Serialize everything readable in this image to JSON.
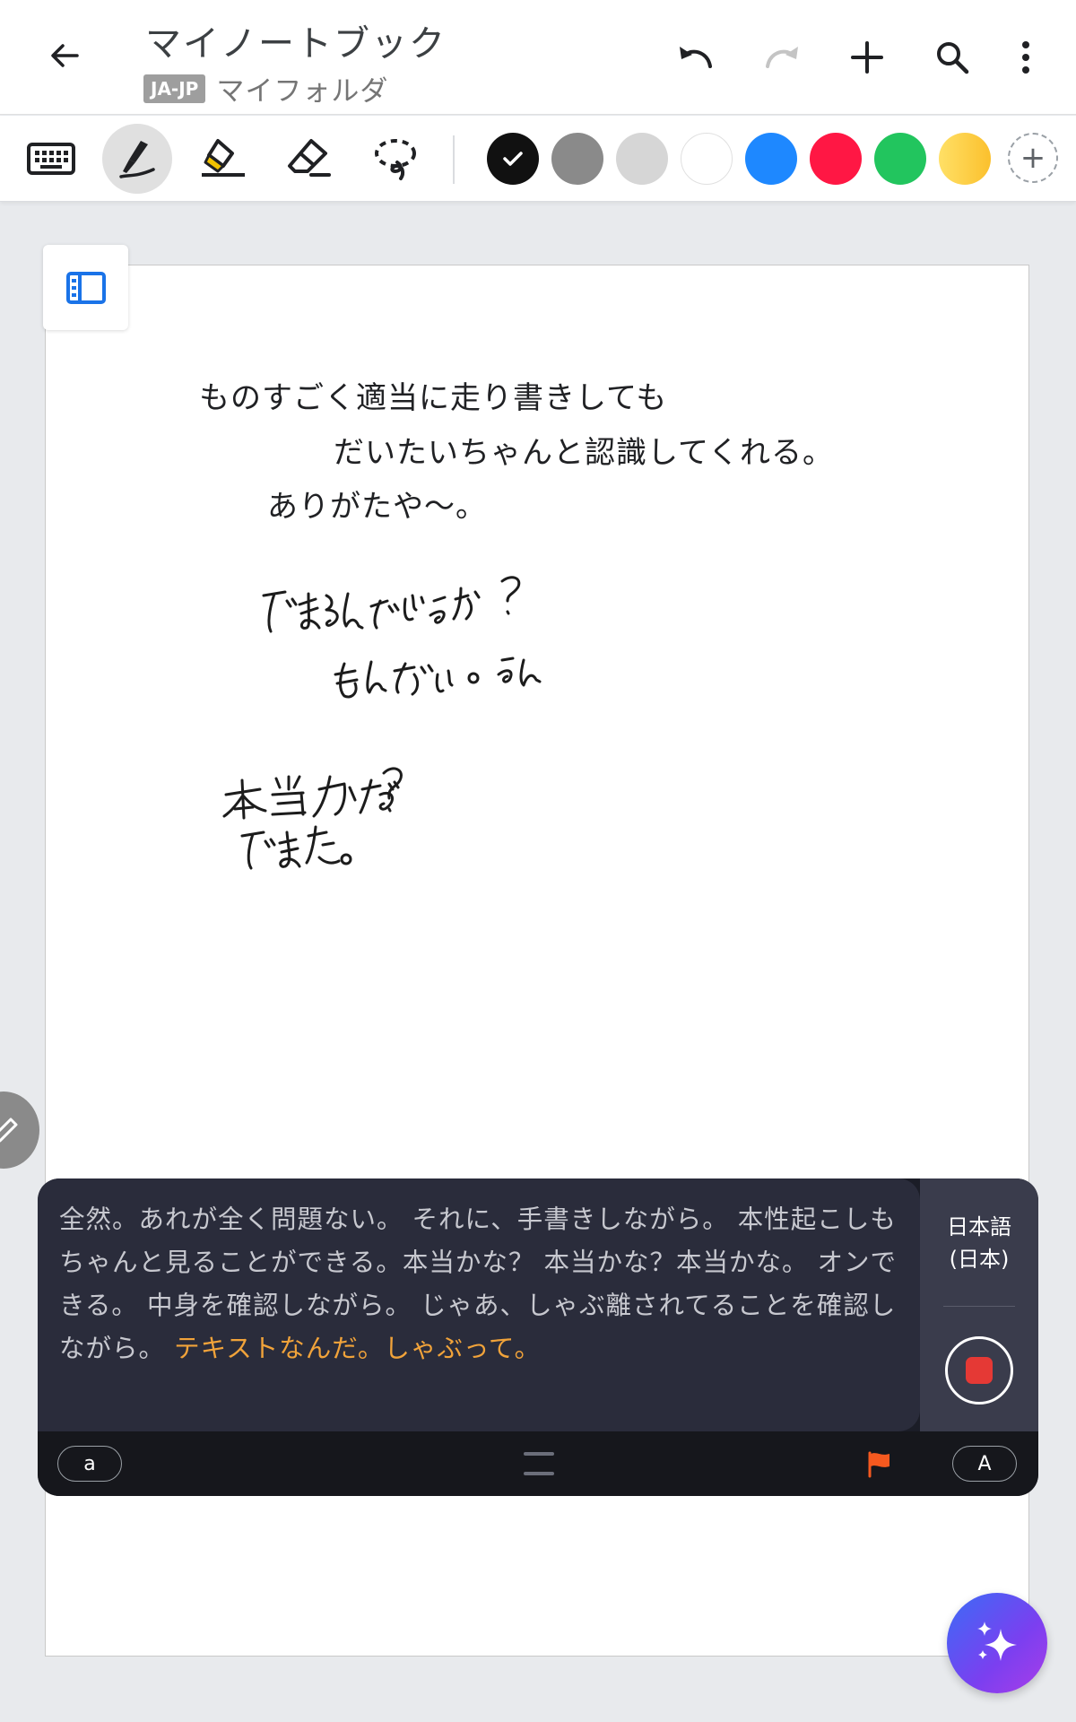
{
  "header": {
    "title": "マイノートブック",
    "lang_badge": "JA-JP",
    "folder": "マイフォルダ",
    "icons": [
      "back-arrow-icon",
      "undo-icon",
      "redo-icon",
      "plus-icon",
      "search-icon",
      "more-vert-icon"
    ]
  },
  "toolbar": {
    "tools": [
      "keyboard-icon",
      "pen-icon",
      "highlighter-icon",
      "eraser-icon",
      "lasso-icon"
    ],
    "active_tool": "pen-icon",
    "colors": [
      "#111111",
      "#8a8a8a",
      "#d6d6d6",
      "#ffffff",
      "#1e88ff",
      "#ff1744",
      "#22c55e",
      "#fdd835"
    ],
    "selected_color": "#111111",
    "add_color_label": "+"
  },
  "note": {
    "typed_lines": [
      "ものすごく適当に走り書きしても",
      "だいたいちゃんと認識してくれる。",
      "ありがたや〜。"
    ],
    "handwriting": [
      "できるんでしょうか？",
      "もんだい。うん",
      "本当かな？",
      "できた。"
    ]
  },
  "voice_panel": {
    "transcript_final": "全然。あれが全く問題ない。 それに、手書きしながら。 本性起こしもちゃんと見ることができる。本当かな？ 本当かな？本当かな。 オンできる。 中身を確認しながら。 じゃあ、しゃぶ離されてることを確認しながら。 ",
    "transcript_pending": "テキストなんだ。しゃぶって。",
    "language_line1": "日本語",
    "language_line2": "(日本)",
    "lower_case_label": "a",
    "upper_case_label": "A",
    "colors": {
      "pending": "#f1a33a",
      "record": "#e53935",
      "flag": "#f5591f"
    }
  }
}
